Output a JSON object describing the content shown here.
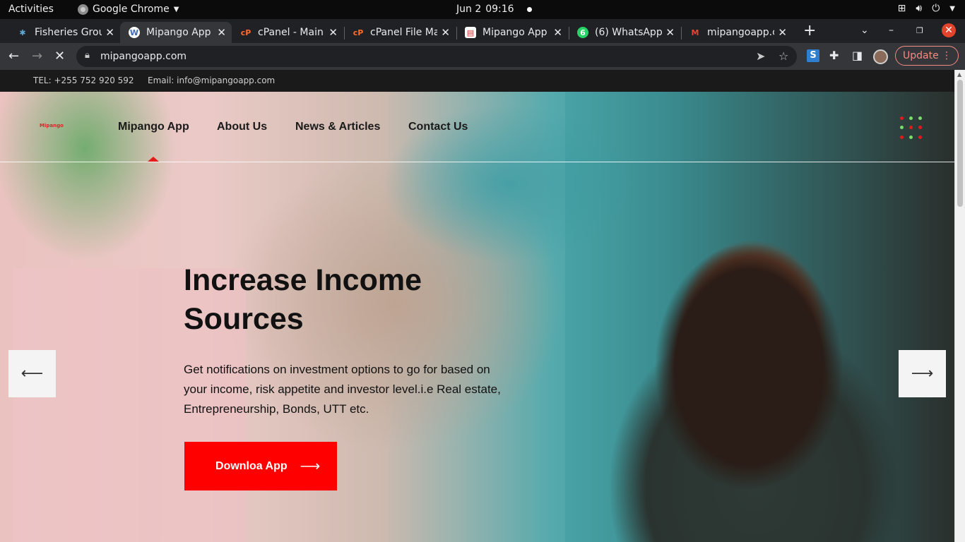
{
  "os": {
    "activities": "Activities",
    "app_name": "Google Chrome",
    "date": "Jun 2",
    "time": "09:16"
  },
  "tabs": [
    {
      "title": "Fisheries Grou",
      "favicon": "snowflake-icon",
      "active": false
    },
    {
      "title": "Mipango App",
      "favicon": "wordpress-icon",
      "active": true
    },
    {
      "title": "cPanel - Main",
      "favicon": "cpanel-icon",
      "active": false
    },
    {
      "title": "cPanel File Ma",
      "favicon": "cpanel-icon",
      "active": false
    },
    {
      "title": "Mipango App",
      "favicon": "mipango-icon",
      "active": false
    },
    {
      "title": "(6) WhatsApp",
      "favicon": "whatsapp-icon",
      "active": false
    },
    {
      "title": "mipangoapp.c",
      "favicon": "gmail-icon",
      "active": false
    }
  ],
  "browser": {
    "url": "mipangoapp.com",
    "update_label": "Update"
  },
  "site": {
    "tel": "TEL: +255 752 920 592",
    "email": "Email: info@mipangoapp.com",
    "logo_text": "Mipango",
    "nav": [
      "Mipango App",
      "About Us",
      "News & Articles",
      "Contact Us"
    ],
    "hero": {
      "headline": "Increase Income Sources",
      "body": "Get notifications on investment options to go for based on your income, risk appetite and investor level.i.e Real estate, Entrepreneurship, Bonds, UTT etc.",
      "cta_label": "Downloa App"
    }
  },
  "colors": {
    "accent": "#ff0000",
    "tab_bar": "#202124",
    "toolbar": "#35363a"
  }
}
